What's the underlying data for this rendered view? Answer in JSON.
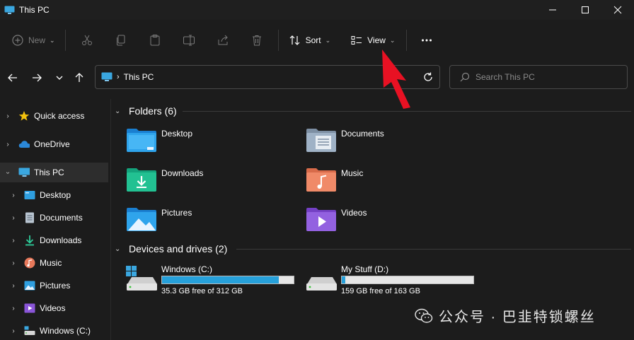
{
  "window": {
    "title": "This PC"
  },
  "toolbar": {
    "new_label": "New",
    "sort_label": "Sort",
    "view_label": "View",
    "icons": [
      "cut-icon",
      "copy-icon",
      "paste-icon",
      "rename-icon",
      "share-icon",
      "delete-icon",
      "more-icon"
    ]
  },
  "address": {
    "location": "This PC",
    "search_placeholder": "Search This PC"
  },
  "sidebar": {
    "items": [
      {
        "label": "Quick access",
        "icon": "star-icon"
      },
      {
        "label": "OneDrive",
        "icon": "cloud-icon"
      },
      {
        "label": "This PC",
        "icon": "monitor-icon",
        "selected": true
      },
      {
        "label": "Desktop",
        "icon": "desktop-folder-icon"
      },
      {
        "label": "Documents",
        "icon": "documents-icon"
      },
      {
        "label": "Downloads",
        "icon": "downloads-icon"
      },
      {
        "label": "Music",
        "icon": "music-icon"
      },
      {
        "label": "Pictures",
        "icon": "pictures-icon"
      },
      {
        "label": "Videos",
        "icon": "videos-icon"
      },
      {
        "label": "Windows (C:)",
        "icon": "drive-icon"
      }
    ]
  },
  "main": {
    "folders_header": "Folders (6)",
    "folders": [
      {
        "label": "Desktop",
        "icon": "desktop-folder-icon"
      },
      {
        "label": "Documents",
        "icon": "documents-folder-icon"
      },
      {
        "label": "Downloads",
        "icon": "downloads-folder-icon"
      },
      {
        "label": "Music",
        "icon": "music-folder-icon"
      },
      {
        "label": "Pictures",
        "icon": "pictures-folder-icon"
      },
      {
        "label": "Videos",
        "icon": "videos-folder-icon"
      }
    ],
    "drives_header": "Devices and drives (2)",
    "drives": [
      {
        "name": "Windows (C:)",
        "free": "35.3 GB free of 312 GB",
        "used_fraction": 0.887
      },
      {
        "name": "My Stuff (D:)",
        "free": "159 GB free of 163 GB",
        "used_fraction": 0.025
      }
    ]
  },
  "watermark": {
    "text": "公众号 · 巴韭特锁螺丝"
  },
  "colors": {
    "background": "#1c1c1c",
    "accent": "#26a0da",
    "arrow": "#e81123"
  }
}
